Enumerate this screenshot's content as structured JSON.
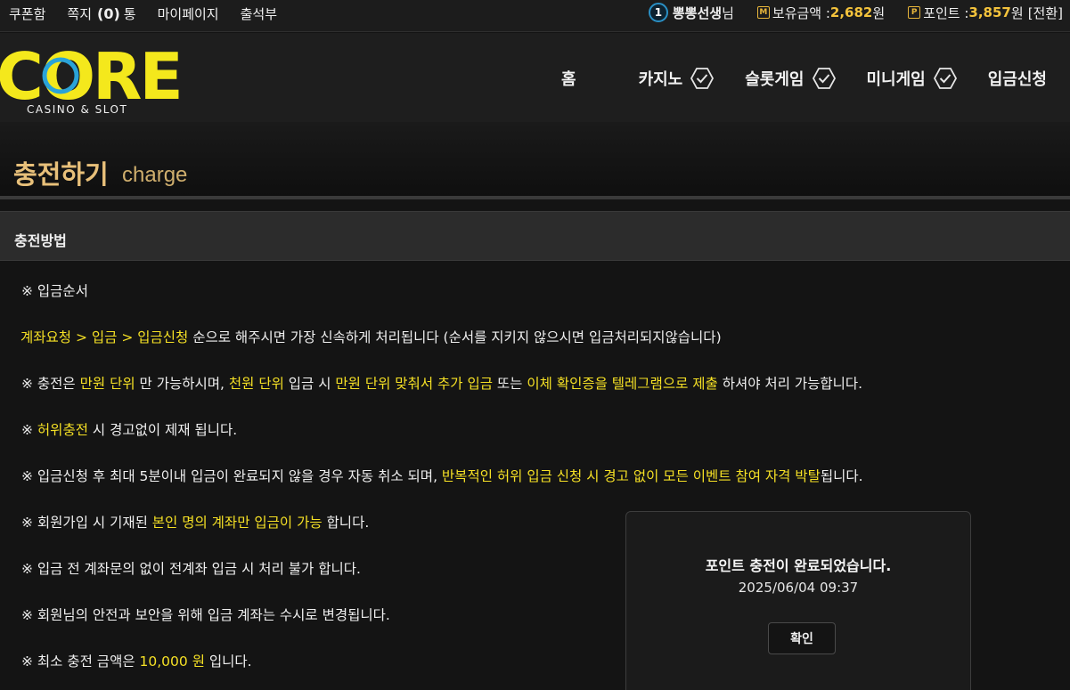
{
  "topbar": {
    "links": [
      "쿠폰함",
      "쪽지",
      "(0)",
      "통",
      "마이페이지",
      "출석부"
    ],
    "level": "1",
    "username": "뽕뽕선생",
    "honorific": "님",
    "balance_icon": "M",
    "balance_label": "보유금액 : ",
    "balance_value": "2,682",
    "balance_unit": "원",
    "point_icon": "P",
    "point_label": "포인트 : ",
    "point_value": "3,857",
    "point_unit": "원",
    "convert_label": "[전환]"
  },
  "logo": {
    "main": "CORE",
    "sub": "CASINO & SLOT"
  },
  "nav": [
    "홈",
    "카지노",
    "슬롯게임",
    "미니게임",
    "입금신청"
  ],
  "page": {
    "title": "충전하기",
    "subtitle": "charge"
  },
  "section": {
    "title": "충전방법"
  },
  "content": {
    "l1": "※ 입금순서",
    "l2a": "계좌요청 > 입금 > 입금신청",
    "l2b": " 순으로 해주시면 가장 신속하게 처리됩니다 (순서를 지키지 않으시면 입금처리되지않습니다)",
    "l3a": "※ 충전은 ",
    "l3b": "만원 단위",
    "l3c": " 만 가능하시며, ",
    "l3d": "천원 단위",
    "l3e": " 입금 시 ",
    "l3f": "만원 단위 맞춰서 추가 입금",
    "l3g": " 또는 ",
    "l3h": "이체 확인증을 텔레그램으로 제출",
    "l3i": " 하셔야 처리 가능합니다.",
    "l4a": "※ ",
    "l4b": "허위충전",
    "l4c": " 시 경고없이 제재 됩니다.",
    "l5a": "※ 입금신청 후 최대 5분이내 입금이 완료되지 않을 경우 자동 취소 되며, ",
    "l5b": "반복적인 허위 입금 신청 시 경고 없이 모든 이벤트 참여 자격 박탈",
    "l5c": "됩니다.",
    "l6a": "※ 회원가입 시 기재된 ",
    "l6b": "본인 명의 계좌만 입금이 가능",
    "l6c": " 합니다.",
    "l7": "※ 입금 전 계좌문의 없이 전계좌 입금 시 처리 불가 합니다.",
    "l8": "※ 회원님의 안전과 보안을 위해 입금 계좌는 수시로 변경됩니다.",
    "l9a": "※ 최소 충전 금액은 ",
    "l9b": "10,000 원",
    "l9c": " 입니다."
  },
  "popup": {
    "message": "포인트 충전이 완료되었습니다.",
    "datetime": "2025/06/04 09:37",
    "button": "확인"
  },
  "colors": {
    "highlight": "#f5e025",
    "logo": "#f4e81c",
    "logo_ring": "#2aa3d8",
    "gold": "#f4c33c"
  }
}
